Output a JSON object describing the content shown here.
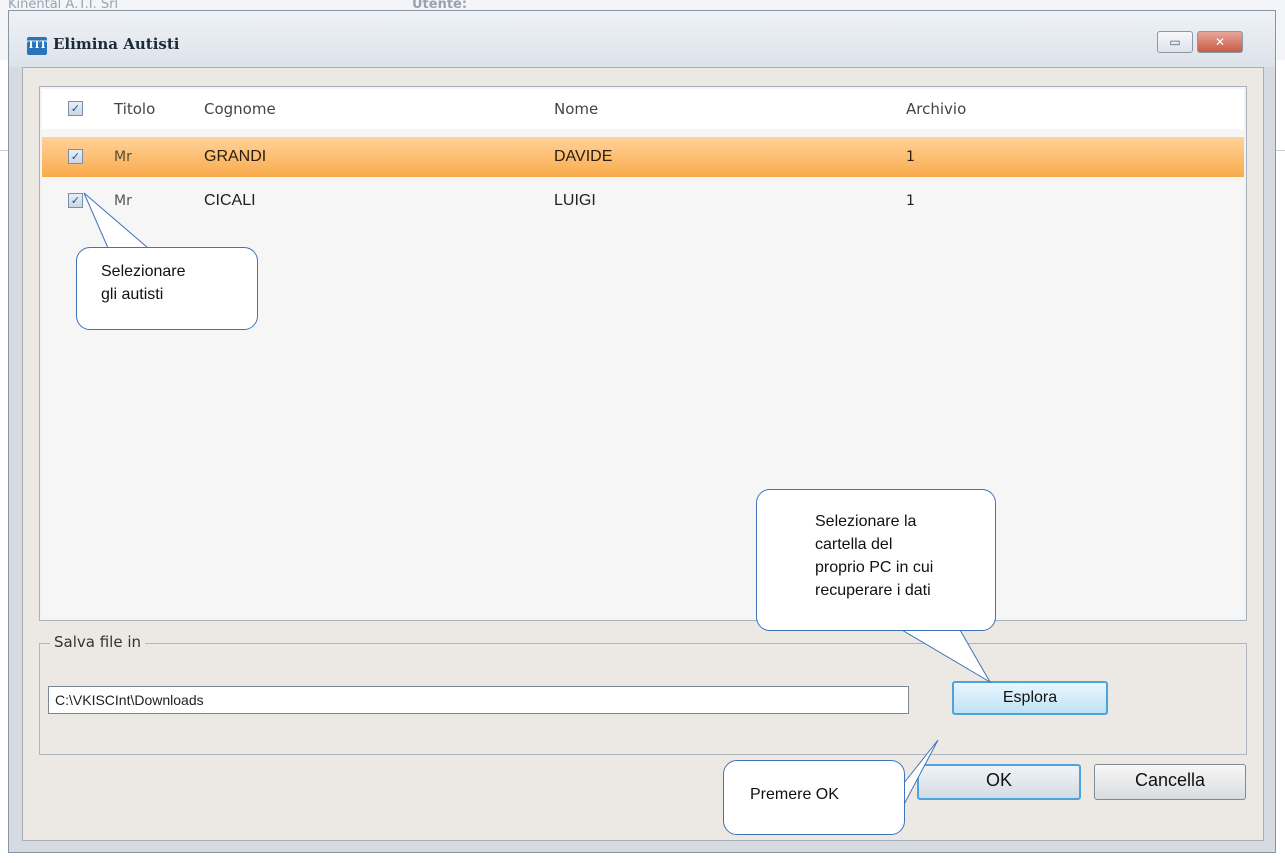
{
  "background": {
    "company_text": "Kinental A.T.I. Srl",
    "user_label": "Utente:"
  },
  "window": {
    "icon_text": "TIT",
    "title": "Elimina Autisti",
    "restore_glyph": "▭",
    "close_glyph": "✕"
  },
  "table": {
    "check_mark": "✓",
    "headers": {
      "titolo": "Titolo",
      "cognome": "Cognome",
      "nome": "Nome",
      "archivio": "Archivio"
    },
    "rows": [
      {
        "checked": true,
        "titolo": "Mr",
        "cognome": "GRANDI",
        "nome": "DAVIDE",
        "archivio": "1",
        "selected": true
      },
      {
        "checked": true,
        "titolo": "Mr",
        "cognome": "CICALI",
        "nome": "LUIGI",
        "archivio": "1",
        "selected": false
      }
    ]
  },
  "save_group": {
    "legend": "Salva file in",
    "path_value": "C:\\VKISCInt\\Downloads",
    "browse_label": "Esplora"
  },
  "footer": {
    "ok_label": "OK",
    "cancel_label": "Cancella"
  },
  "callouts": {
    "select_drivers_line1": "Selezionare",
    "select_drivers_line2": "gli autisti",
    "folder_line1": "Selezionare la",
    "folder_line2": "cartella del",
    "folder_line3": "proprio PC in cui",
    "folder_line4": "recuperare i dati",
    "press_ok": "Premere OK"
  },
  "colors": {
    "selected_row": "#f9ab4b",
    "focus_button_border": "#4da4dc",
    "callout_border": "#3f74b8"
  }
}
